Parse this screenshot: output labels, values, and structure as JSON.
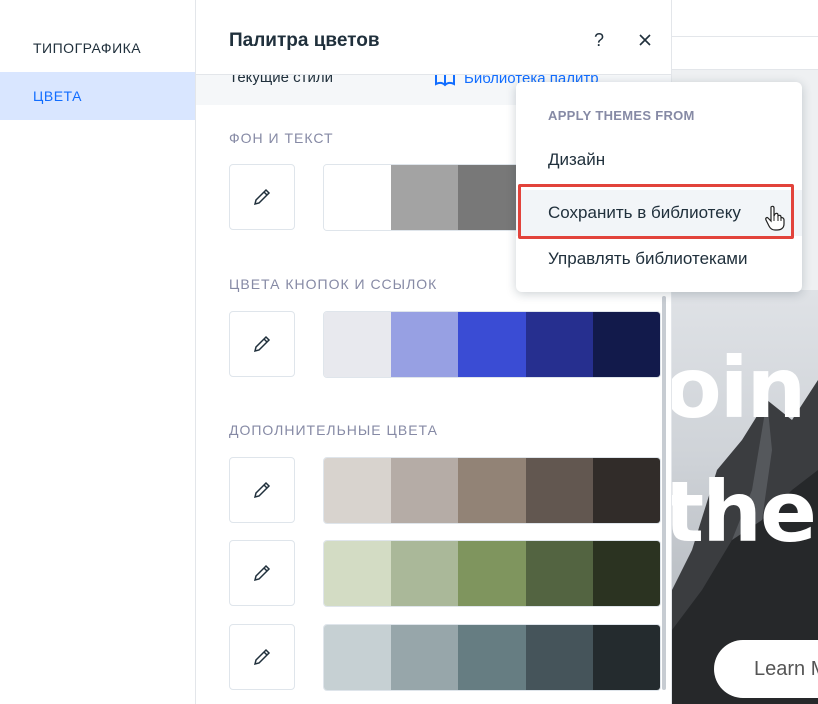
{
  "left_nav": {
    "items": [
      {
        "label": "ТИПОГРАФИКА",
        "active": false
      },
      {
        "label": "ЦВЕТА",
        "active": true
      }
    ]
  },
  "panel": {
    "title": "Палитра цветов",
    "help_icon": "question-icon",
    "close_icon": "close-icon",
    "current_styles_label": "Текущие стили",
    "library_link_label": "Библиотека палитр",
    "sections": [
      {
        "title": "ФОН И ТЕКСТ",
        "palettes": [
          {
            "swatches": [
              "#ffffff",
              "#a3a3a3",
              "#787878",
              "#4b4b4b",
              "#2b2b2b"
            ]
          }
        ]
      },
      {
        "title": "ЦВЕТА КНОПОК И ССЫЛОК",
        "palettes": [
          {
            "swatches": [
              "#e8e9ee",
              "#97a0e3",
              "#3a4cd4",
              "#262f8f",
              "#121a4b"
            ]
          }
        ]
      },
      {
        "title": "ДОПОЛНИТЕЛЬНЫЕ ЦВЕТА",
        "palettes": [
          {
            "swatches": [
              "#d8d3ce",
              "#b5aca6",
              "#928376",
              "#625750",
              "#312c29"
            ]
          },
          {
            "swatches": [
              "#d3dcc4",
              "#aab899",
              "#7f955e",
              "#536441",
              "#2b3321"
            ]
          },
          {
            "swatches": [
              "#c6d0d3",
              "#97a6aa",
              "#667d82",
              "#45545a",
              "#242b2e"
            ]
          }
        ]
      }
    ]
  },
  "dropdown": {
    "header": "APPLY THEMES FROM",
    "items": [
      {
        "label": "Дизайн"
      },
      {
        "label": "Сохранить в библиотеку",
        "highlighted": true
      },
      {
        "label": "Управлять библиотеками"
      }
    ]
  },
  "preview": {
    "hero_line1": "oin",
    "hero_line2": "the",
    "cta_label": "Learn M"
  },
  "colors": {
    "accent": "#116dff",
    "active_nav_bg": "#d9e6ff",
    "highlight_border": "#e2433b"
  }
}
